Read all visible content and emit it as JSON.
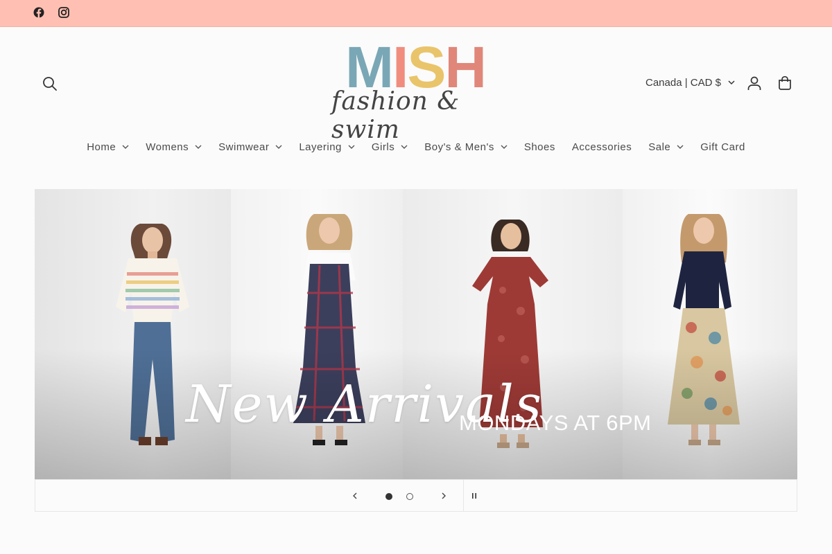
{
  "announcement_bar": {
    "background": "#ffc0b3",
    "social": [
      {
        "icon": "facebook-icon"
      },
      {
        "icon": "instagram-icon"
      }
    ]
  },
  "header": {
    "search_icon": "search-icon",
    "logo": {
      "letters": [
        "M",
        "I",
        "S",
        "H"
      ],
      "letter_colors": [
        "#7aa7b5",
        "#f08d7e",
        "#e9c46a",
        "#e0877a"
      ],
      "tagline": "fashion & swim"
    },
    "currency_label": "Canada | CAD $",
    "account_icon": "account-icon",
    "cart_icon": "cart-icon"
  },
  "nav": {
    "items": [
      {
        "label": "Home",
        "has_dropdown": true
      },
      {
        "label": "Womens",
        "has_dropdown": true
      },
      {
        "label": "Swimwear",
        "has_dropdown": true
      },
      {
        "label": "Layering",
        "has_dropdown": true
      },
      {
        "label": "Girls",
        "has_dropdown": true
      },
      {
        "label": "Boy's & Men's",
        "has_dropdown": true
      },
      {
        "label": "Shoes",
        "has_dropdown": false
      },
      {
        "label": "Accessories",
        "has_dropdown": false
      },
      {
        "label": "Sale",
        "has_dropdown": true
      },
      {
        "label": "Gift Card",
        "has_dropdown": false
      }
    ]
  },
  "hero": {
    "script_text": "New Arrivals",
    "caps_text": "MONDAYS AT 6PM"
  },
  "slideshow": {
    "slide_count": 2,
    "active_slide": 1,
    "prev_icon": "chevron-left-icon",
    "next_icon": "chevron-right-icon",
    "pause_icon": "pause-icon"
  }
}
